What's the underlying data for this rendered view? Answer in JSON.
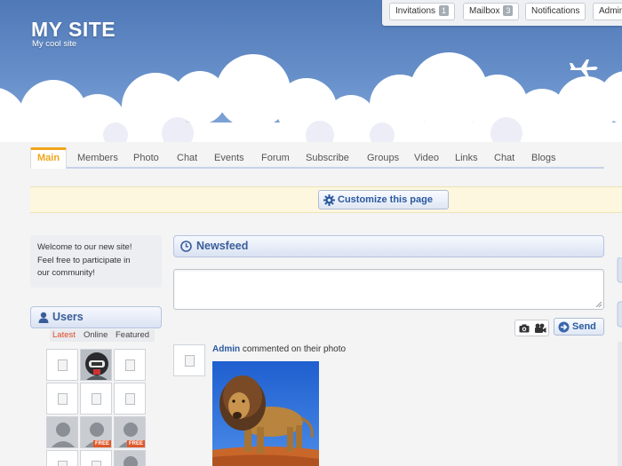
{
  "site": {
    "title": "MY SITE",
    "subtitle": "My cool site"
  },
  "topbar": {
    "invitations": {
      "label": "Invitations",
      "count": "1"
    },
    "mailbox": {
      "label": "Mailbox",
      "count": "3"
    },
    "notifications": {
      "label": "Notifications"
    },
    "admin": {
      "label": "Admin"
    }
  },
  "nav": {
    "tabs": [
      "Main",
      "Members",
      "Photo",
      "Chat",
      "Events",
      "Forum",
      "Subscribe",
      "Groups",
      "Video",
      "Links",
      "Chat",
      "Blogs"
    ],
    "active": "Main"
  },
  "customize": {
    "label": "Customize this page"
  },
  "welcome": {
    "line1": "Welcome to our new site!",
    "line2": "Feel free to participate in",
    "line3": "our community!"
  },
  "users": {
    "title": "Users",
    "filters": [
      "Latest",
      "Online",
      "Featured"
    ],
    "active_filter": "Latest",
    "badge": "FREE"
  },
  "newsfeed": {
    "title": "Newsfeed",
    "send_label": "Send",
    "post": {
      "author": "Admin",
      "action": "commented on their photo"
    }
  },
  "colors": {
    "accent": "#f0a51a",
    "link": "#2b5a9f",
    "sky": "#5b82c0"
  }
}
